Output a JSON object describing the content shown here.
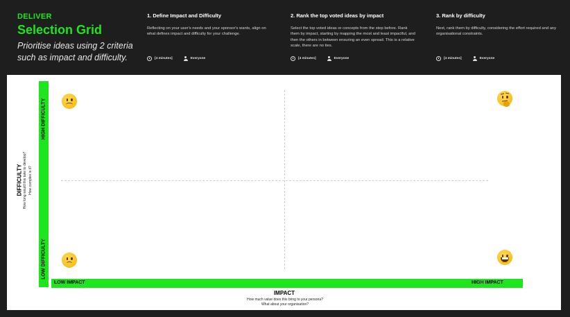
{
  "header": {
    "phase": "DELIVER",
    "title": "Selection Grid",
    "subtitle": "Prioritise ideas using 2 criteria such as impact and difficulty."
  },
  "steps": [
    {
      "title": "1. Define Impact and Difficulty",
      "description": "Reflecting on your user's needs and your sponsor's wants, align on what defines impact and difficulty for your challenge.",
      "duration": "[4 minutes]",
      "who": "Everyone"
    },
    {
      "title": "2. Rank the top voted ideas by impact",
      "description": "Select the top voted ideas or concepts from the step before. Rank them by impact, starting by mapping the most and least impactful, and then the others in between ensuring an even spread. This is a relative scale, there are no ties.",
      "duration": "[4 minutes]",
      "who": "Everyone"
    },
    {
      "title": "3. Rank by difficulty",
      "description": "Next, rank them by difficulty, considering the effort required and any organisational constraints.",
      "duration": "[4 minutes]",
      "who": "Everyone"
    }
  ],
  "grid": {
    "y_axis_title": "DIFFICULTY",
    "y_axis_q1": "How long would this take to develop?",
    "y_axis_q2": "How complex is it?",
    "y_high": "HIGH DIFFICULTY",
    "y_low": "LOW DIFFICULTY",
    "x_axis_title": "IMPACT",
    "x_axis_q1": "How much value does this bring to your persona?",
    "x_axis_q2": "What about your organisation?",
    "x_low": "LOW IMPACT",
    "x_high": "HIGH IMPACT"
  },
  "colors": {
    "accent": "#1fe51f",
    "background": "#1e1e1e",
    "board": "#ffffff"
  },
  "icons": [
    "clock-icon",
    "person-icon",
    "frowning-face-icon",
    "thinking-face-icon",
    "slightly-frowning-face-icon",
    "grinning-face-icon"
  ]
}
